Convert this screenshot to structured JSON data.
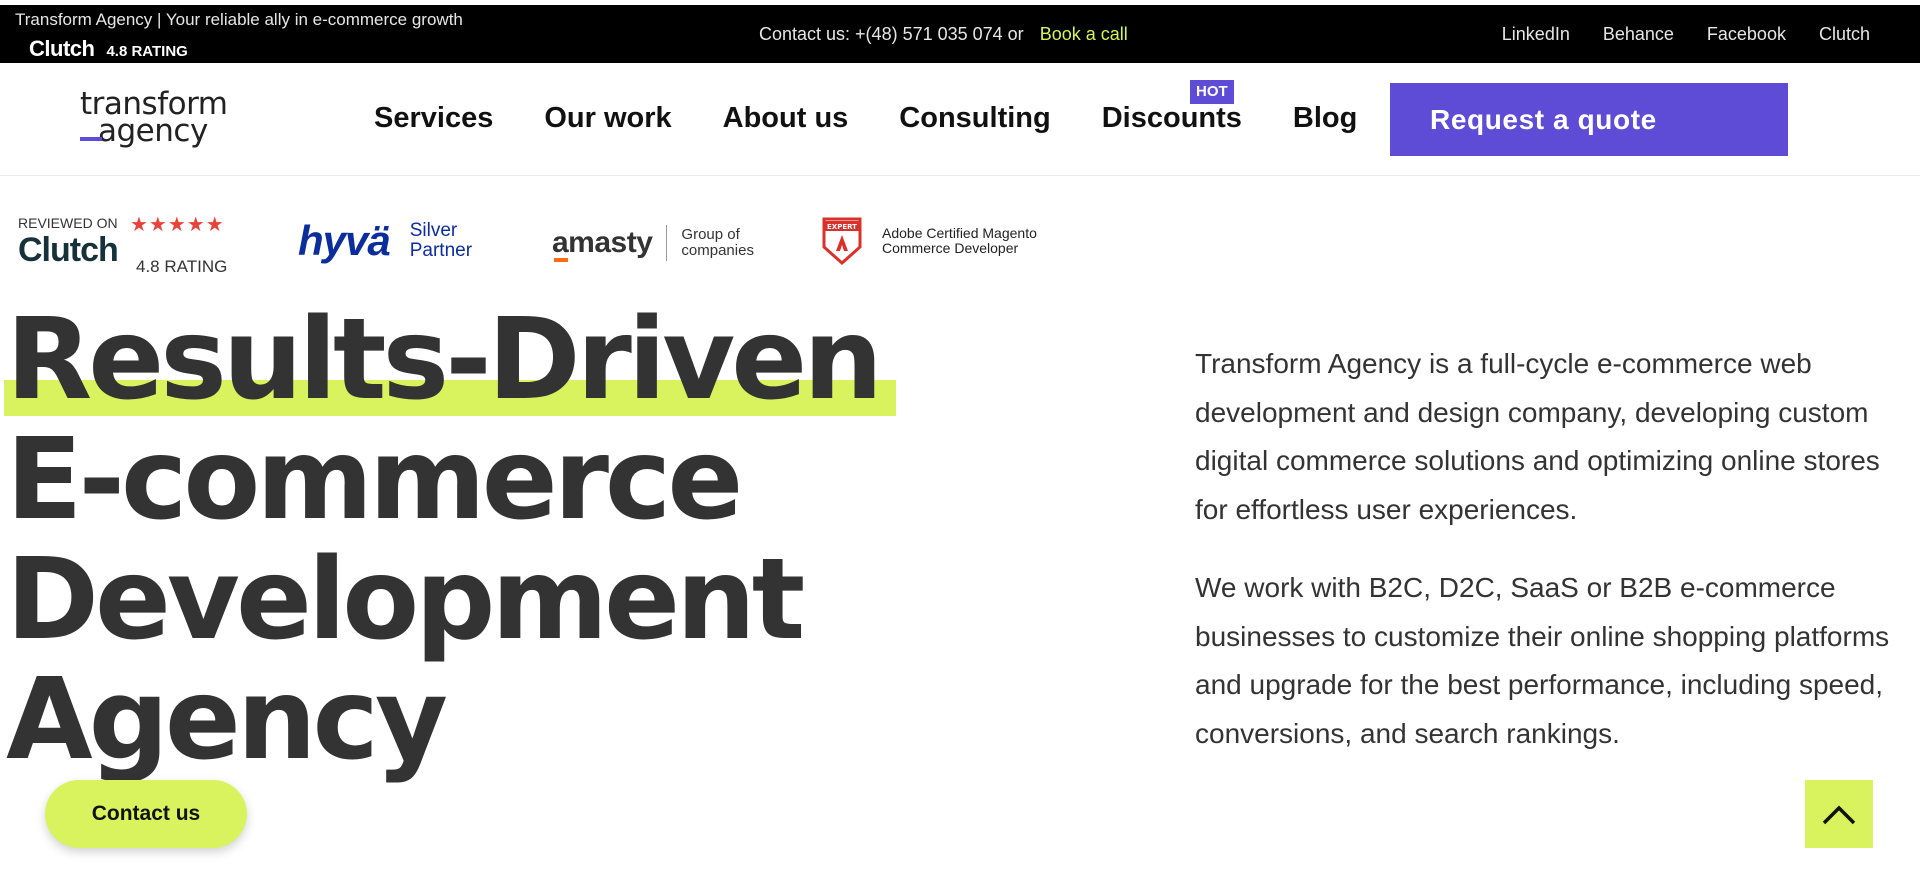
{
  "topbar": {
    "tagline": "Transform Agency | Your reliable ally in e-commerce growth",
    "clutch_word": "Clutch",
    "clutch_rating": "4.8 RATING",
    "contact_text": "Contact us: +(48) 571 035 074 or",
    "book_call": "Book a call",
    "social": [
      "LinkedIn",
      "Behance",
      "Facebook",
      "Clutch"
    ]
  },
  "header": {
    "logo_line1": "transform",
    "logo_line2": "agency",
    "nav": [
      "Services",
      "Our work",
      "About us",
      "Consulting",
      "Discounts",
      "Blog"
    ],
    "hot_badge": "HOT",
    "quote_button": "Request a quote"
  },
  "badges": {
    "clutch_reviewed": "REVIEWED ON",
    "clutch_stars": "★★★★★",
    "clutch_word": "Clutch",
    "clutch_rating": "4.8 RATING",
    "hyva_word": "hyvä",
    "hyva_sub1": "Silver",
    "hyva_sub2": "Partner",
    "amasty_word": "amasty",
    "amasty_sub1": "Group of",
    "amasty_sub2": "companies",
    "adobe_expert": "EXPERT",
    "adobe_sub1": "Adobe Certified Magento",
    "adobe_sub2": "Commerce Developer"
  },
  "hero": {
    "title_lines": [
      "Results-Driven",
      "E-commerce",
      "Development",
      "Agency"
    ],
    "paragraph1": "Transform Agency is a full-cycle e-commerce web development and design company, developing custom digital commerce solutions and optimizing online stores for effortless user experiences.",
    "paragraph2": "We work with B2C, D2C, SaaS or B2B e-commerce businesses to customize their online shopping platforms and upgrade for the best performance, including speed, conversions, and search rankings."
  },
  "contact_button": "Contact us",
  "colors": {
    "accent_purple": "#5e4bd6",
    "accent_lime": "#d8f35d",
    "clutch_star": "#e8423a"
  }
}
